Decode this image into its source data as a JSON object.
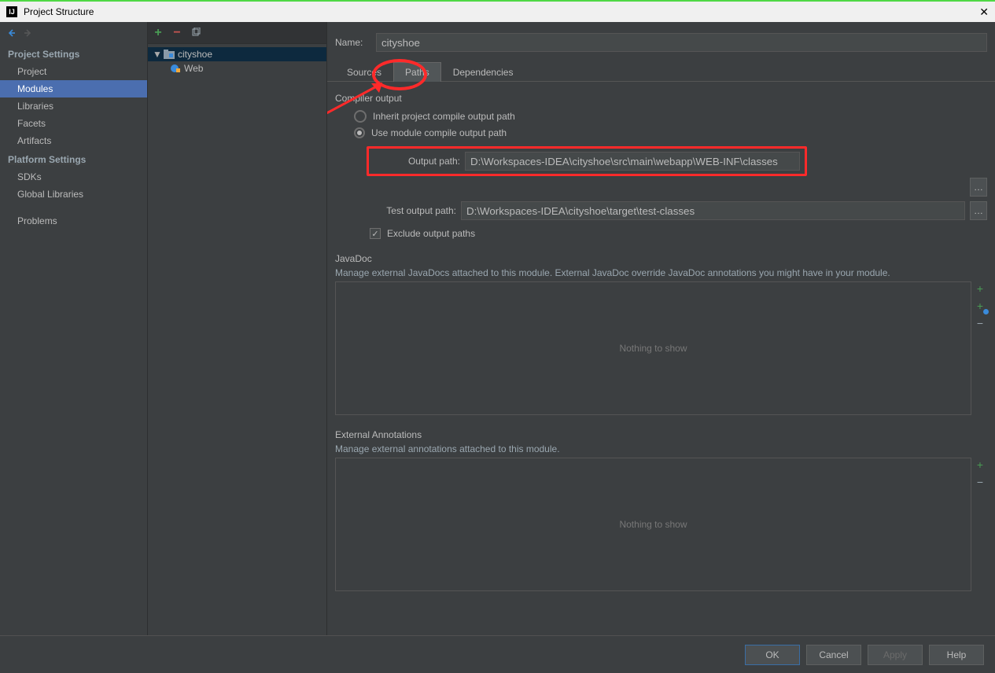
{
  "window": {
    "title": "Project Structure"
  },
  "sidebar": {
    "sections": [
      {
        "title": "Project Settings",
        "items": [
          "Project",
          "Modules",
          "Libraries",
          "Facets",
          "Artifacts"
        ],
        "selected": "Modules"
      },
      {
        "title": "Platform Settings",
        "items": [
          "SDKs",
          "Global Libraries"
        ]
      },
      {
        "title": "",
        "items": [
          "Problems"
        ]
      }
    ]
  },
  "tree": {
    "root": {
      "label": "cityshoe",
      "children": [
        {
          "label": "Web"
        }
      ]
    }
  },
  "main": {
    "nameLabel": "Name:",
    "nameValue": "cityshoe",
    "tabs": [
      "Sources",
      "Paths",
      "Dependencies"
    ],
    "activeTab": "Paths",
    "compiler": {
      "section": "Compiler output",
      "inheritLabel": "Inherit project compile output path",
      "useModuleLabel": "Use module compile output path",
      "outputPathLabel": "Output path:",
      "outputPathValue": "D:\\Workspaces-IDEA\\cityshoe\\src\\main\\webapp\\WEB-INF\\classes",
      "testOutputLabel": "Test output path:",
      "testOutputValue": "D:\\Workspaces-IDEA\\cityshoe\\target\\test-classes",
      "excludeLabel": "Exclude output paths"
    },
    "javadoc": {
      "section": "JavaDoc",
      "desc": "Manage external JavaDocs attached to this module. External JavaDoc override JavaDoc annotations you might have in your module.",
      "empty": "Nothing to show"
    },
    "extAnn": {
      "section": "External Annotations",
      "desc": "Manage external annotations attached to this module.",
      "empty": "Nothing to show"
    }
  },
  "buttons": {
    "ok": "OK",
    "cancel": "Cancel",
    "apply": "Apply",
    "help": "Help"
  }
}
